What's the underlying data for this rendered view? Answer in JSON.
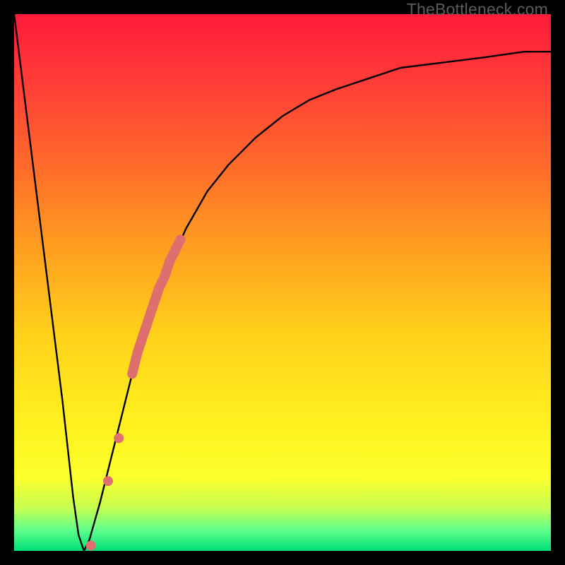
{
  "watermark": "TheBottleneck.com",
  "chart_data": {
    "type": "line",
    "title": "",
    "xlabel": "",
    "ylabel": "",
    "xlim": [
      0,
      100
    ],
    "ylim": [
      0,
      100
    ],
    "grid": false,
    "legend": false,
    "series": [
      {
        "name": "bottleneck-curve",
        "color": "#000000",
        "x": [
          0,
          3,
          6,
          9,
          11,
          12,
          13,
          14,
          16,
          18,
          20,
          22,
          25,
          28,
          32,
          36,
          40,
          45,
          50,
          55,
          60,
          66,
          72,
          80,
          88,
          95,
          100
        ],
        "y": [
          100,
          76,
          52,
          28,
          10,
          3,
          0,
          2,
          9,
          17,
          25,
          33,
          43,
          51,
          60,
          67,
          72,
          77,
          81,
          84,
          86,
          88,
          90,
          91,
          92,
          93,
          93
        ]
      }
    ],
    "markers": [
      {
        "name": "highlight-segment",
        "color": "#e07070",
        "style": "thick-round",
        "x": [
          22,
          23,
          24,
          25,
          26,
          27,
          28,
          29,
          30,
          31
        ],
        "y": [
          33,
          37,
          40,
          43,
          46,
          49,
          51,
          54,
          56,
          58
        ]
      },
      {
        "name": "highlight-dots",
        "color": "#e07070",
        "style": "dots",
        "points": [
          {
            "x": 14.3,
            "y": 1
          },
          {
            "x": 17.5,
            "y": 13
          },
          {
            "x": 19.5,
            "y": 21
          }
        ]
      }
    ]
  }
}
